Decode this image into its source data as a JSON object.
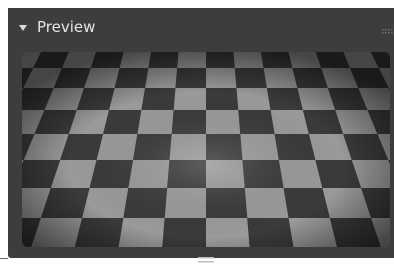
{
  "panel": {
    "title": "Preview",
    "expanded": true,
    "icons": {
      "collapse": "triangle-down-icon",
      "grip": "drag-grip-icon",
      "resize": "resize-handle-icon"
    },
    "colors": {
      "panel_bg": "#3d3d3d",
      "title_text": "#e6e6e6",
      "checker_light": "#9a9a9a",
      "checker_dark": "#3a3a3a"
    }
  },
  "preview": {
    "type": "checkerboard-floor"
  }
}
